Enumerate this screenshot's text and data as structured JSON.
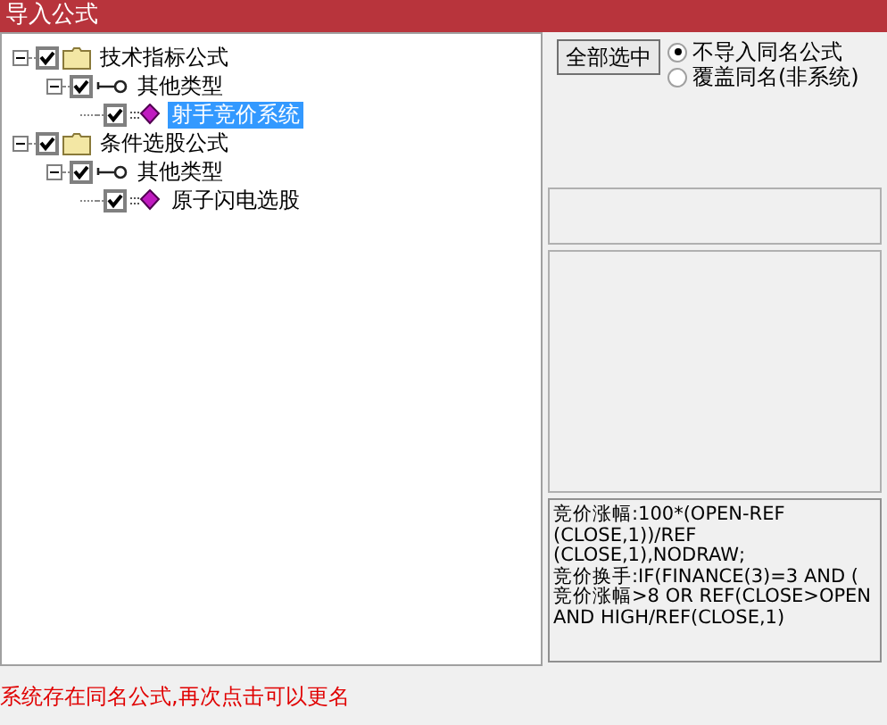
{
  "window": {
    "title": "导入公式"
  },
  "tree": [
    {
      "label": "技术指标公式",
      "kind": "folder",
      "checked": true,
      "expanded": true,
      "selected": false,
      "children": [
        {
          "label": "其他类型",
          "kind": "type",
          "checked": true,
          "expanded": true,
          "selected": false,
          "children": [
            {
              "label": "射手竞价系统",
              "kind": "formula",
              "checked": true,
              "selected": true
            }
          ]
        }
      ]
    },
    {
      "label": "条件选股公式",
      "kind": "folder",
      "checked": true,
      "expanded": true,
      "selected": false,
      "children": [
        {
          "label": "其他类型",
          "kind": "type",
          "checked": true,
          "expanded": true,
          "selected": false,
          "children": [
            {
              "label": "原子闪电选股",
              "kind": "formula",
              "checked": true,
              "selected": false
            }
          ]
        }
      ]
    }
  ],
  "select_all_button": "全部选中",
  "options": [
    {
      "label": "不导入同名公式",
      "selected": true
    },
    {
      "label": "覆盖同名(非系统)",
      "selected": false
    }
  ],
  "formula_lines": [
    "竞价涨幅:100*(OPEN-REF",
    "(CLOSE,1))/REF",
    "(CLOSE,1),NODRAW;",
    "竞价换手:IF(FINANCE(3)=3 AND (",
    "竞价涨幅>8 OR REF(CLOSE>OPEN",
    "AND HIGH/REF(CLOSE,1)"
  ],
  "status": "系统存在同名公式,再次点击可以更名"
}
